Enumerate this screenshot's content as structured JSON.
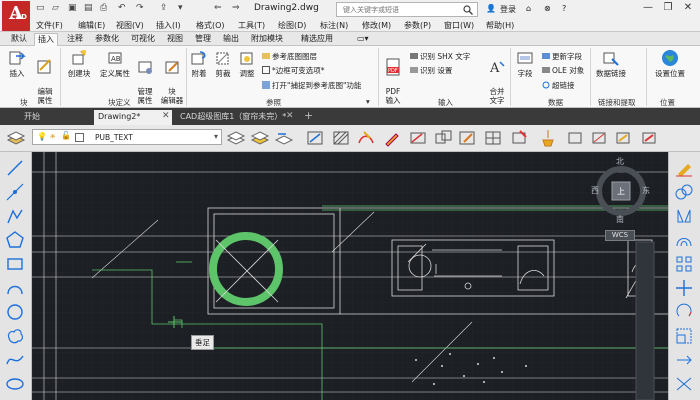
{
  "app": {
    "logo_letter": "A",
    "logo_sub": "CAD",
    "document_title": "Drawing2.dwg"
  },
  "search": {
    "placeholder": "键入关键字或短语"
  },
  "user": {
    "login_label": "登录"
  },
  "menubar": [
    "文件(F)",
    "编辑(E)",
    "视图(V)",
    "插入(I)",
    "格式(O)",
    "工具(T)",
    "绘图(D)",
    "标注(N)",
    "修改(M)",
    "参数(P)",
    "窗口(W)",
    "帮助(H)"
  ],
  "ribbon_tabs": [
    {
      "label": "默认",
      "active": false
    },
    {
      "label": "插入",
      "active": true
    },
    {
      "label": "注释",
      "active": false
    },
    {
      "label": "参数化",
      "active": false
    },
    {
      "label": "可视化",
      "active": false
    },
    {
      "label": "视图",
      "active": false
    },
    {
      "label": "管理",
      "active": false
    },
    {
      "label": "输出",
      "active": false
    },
    {
      "label": "附加模块",
      "active": false
    },
    {
      "label": "精选应用",
      "active": false
    }
  ],
  "ribbon": {
    "panels": {
      "block": "块",
      "block_def": "块定义",
      "reference": "参照",
      "import": "输入",
      "data": "数据",
      "link_extract": "链接和提取",
      "location": "位置"
    },
    "buttons": {
      "insert": "插入",
      "edit_attr": "编辑\n属性",
      "create_block": "创建块",
      "define_attr": "定义属性",
      "manage_attr": "管理\n属性",
      "block_editor": "块\n编辑器",
      "attach": "附着",
      "clip": "剪裁",
      "adjust": "调整",
      "pdf_import": "PDF\n输入",
      "merge_text": "合并\n文字",
      "field": "字段",
      "data_link": "数据链接",
      "set_location": "设置位置"
    },
    "small": {
      "ref_layer": "参考底图图层",
      "frames_vary": "*边框可变选项*",
      "snap_ref": "打开\"捕捉到参考底图\"功能",
      "recognize_shx": "识别 SHX 文字",
      "recognize_settings": "识别 设置",
      "update_fields": "更新字段",
      "ole_object": "OLE 对象",
      "hyperlink": "超链接"
    }
  },
  "doc_tabs": [
    {
      "label": "开始",
      "active": false
    },
    {
      "label": "Drawing2*",
      "active": true
    },
    {
      "label": "CAD超级图库1（窗帘未完）*",
      "active": false
    }
  ],
  "layer": {
    "current": "PUB_TEXT"
  },
  "viewcube": {
    "north": "北",
    "south": "南",
    "east": "东",
    "west": "西",
    "top": "上",
    "wcs": "WCS"
  },
  "tooltip": "垂足",
  "colors": {
    "canvas_bg": "#1c1f24",
    "accent_green": "#5ec46a",
    "line_white": "#d9d9d9",
    "logo_red": "#c62828"
  }
}
